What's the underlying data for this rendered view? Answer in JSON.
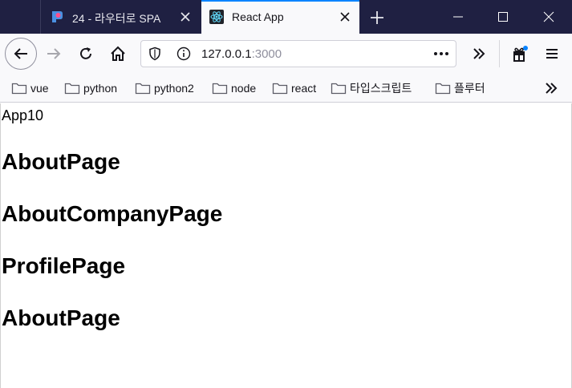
{
  "tabs": [
    {
      "title": "24 - 라우터로 SPA",
      "active": false,
      "favicon": "tistory-favicon-icon"
    },
    {
      "title": "React App",
      "active": true,
      "favicon": "react-favicon-icon"
    }
  ],
  "navbar": {
    "url_host": "127.0.0.1",
    "url_port": ":3000"
  },
  "bookmarks": [
    {
      "label": "vue",
      "icon": "folder-icon"
    },
    {
      "label": "python",
      "icon": "folder-icon"
    },
    {
      "label": "python2",
      "icon": "folder-icon"
    },
    {
      "label": "node",
      "icon": "folder-icon"
    },
    {
      "label": "react",
      "icon": "folder-icon"
    },
    {
      "label": "타입스크립트",
      "icon": "folder-icon"
    },
    {
      "label": "플루터",
      "icon": "folder-icon"
    }
  ],
  "page": {
    "app_text": "App10",
    "headings": [
      "AboutPage",
      "AboutCompanyPage",
      "ProfilePage",
      "AboutPage"
    ]
  },
  "colors": {
    "tabbar_bg": "#1f2042",
    "toolbar_bg": "#f9f9fb",
    "active_tab_accent": "#0a84ff",
    "react_blue": "#61dafb"
  }
}
